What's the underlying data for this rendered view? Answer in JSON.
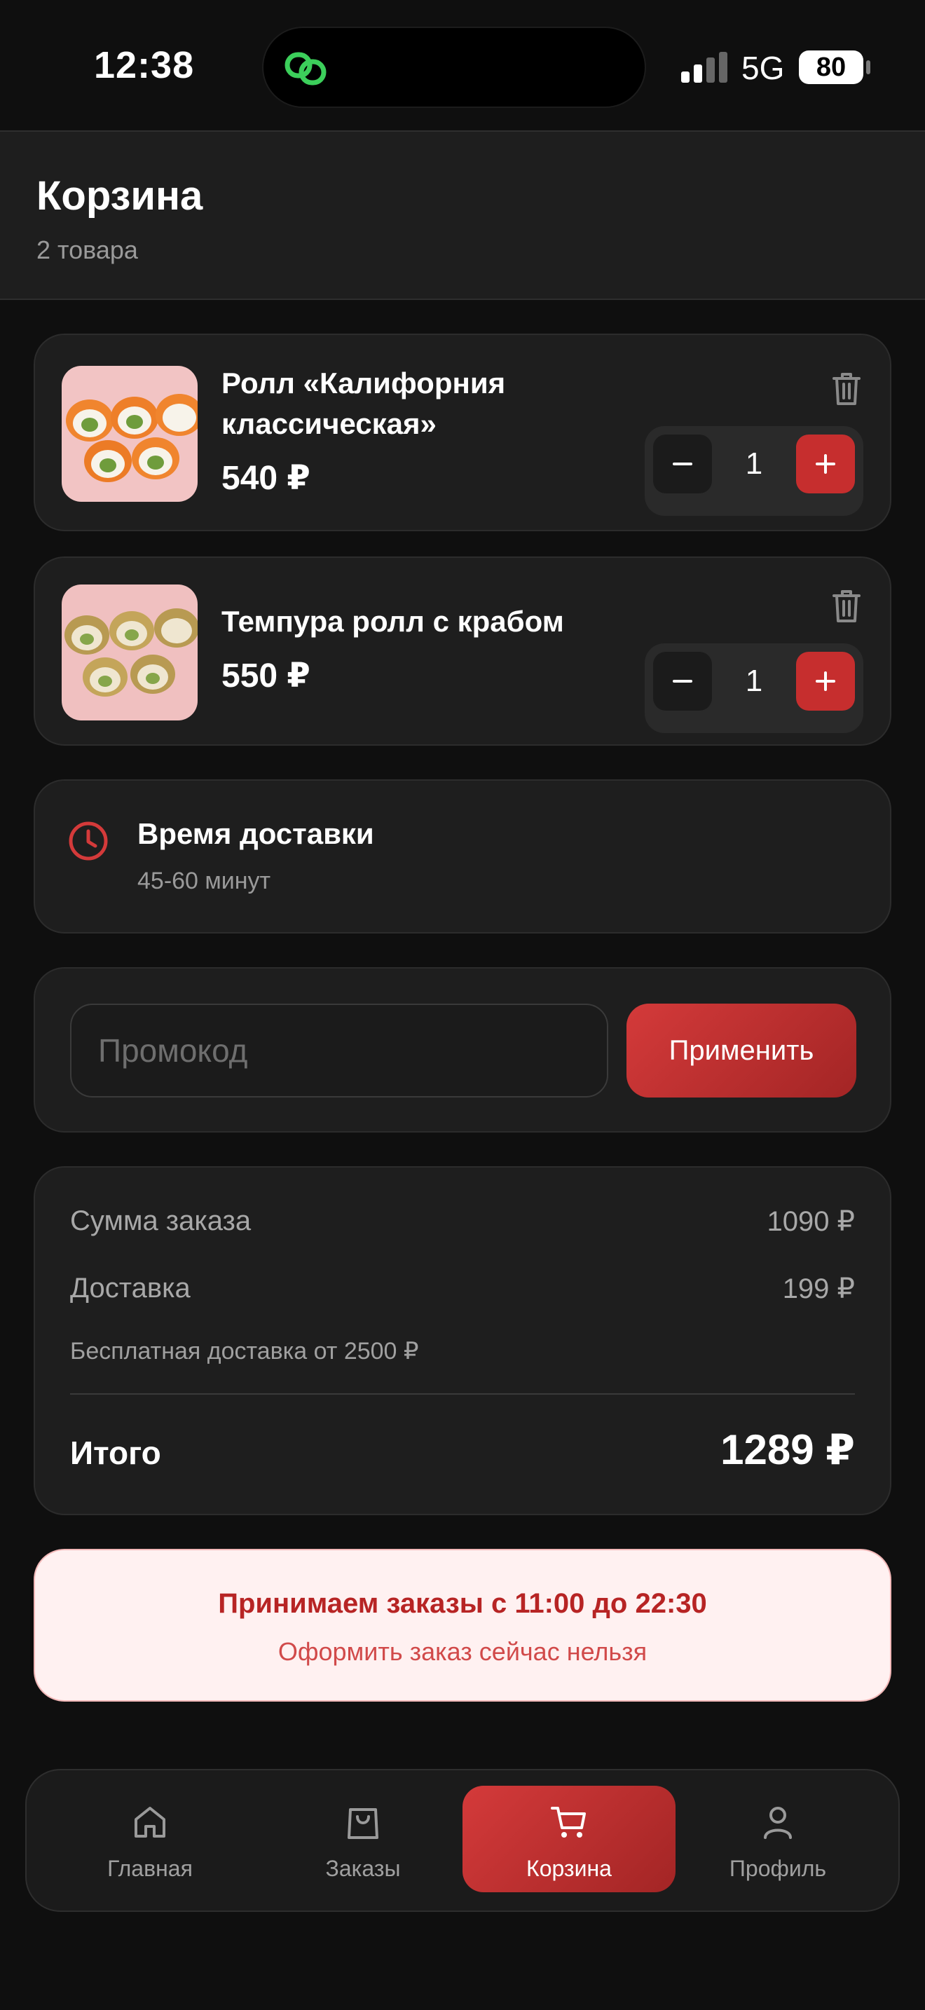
{
  "status_bar": {
    "time": "12:38",
    "network": "5G",
    "battery": "80"
  },
  "header": {
    "title": "Корзина",
    "subtitle": "2 товара"
  },
  "cart": {
    "items": [
      {
        "name": "Ролл «Калифорния классическая»",
        "price": "540 ₽",
        "quantity": "1",
        "icon": "trash-icon"
      },
      {
        "name": "Темпура ролл с крабом",
        "price": "550 ₽",
        "quantity": "1",
        "icon": "trash-icon"
      }
    ]
  },
  "delivery": {
    "title": "Время доставки",
    "time": "45-60 минут",
    "icon": "clock-icon"
  },
  "promo": {
    "placeholder": "Промокод",
    "value": "",
    "apply_label": "Применить"
  },
  "summary": {
    "subtotal_label": "Сумма заказа",
    "subtotal_value": "1090 ₽",
    "delivery_label": "Доставка",
    "delivery_value": "199 ₽",
    "free_delivery_note": "Бесплатная доставка от 2500 ₽",
    "total_label": "Итого",
    "total_value": "1289 ₽"
  },
  "notice": {
    "title": "Принимаем заказы с 11:00 до 22:30",
    "subtitle": "Оформить заказ сейчас нельзя"
  },
  "tabbar": {
    "tabs": [
      {
        "label": "Главная",
        "icon": "home-icon"
      },
      {
        "label": "Заказы",
        "icon": "bag-icon"
      },
      {
        "label": "Корзина",
        "icon": "cart-icon",
        "active": true
      },
      {
        "label": "Профиль",
        "icon": "profile-icon"
      }
    ]
  },
  "colors": {
    "accent": "#c62e2e",
    "background": "#0f0f0f",
    "card": "#1e1e1e",
    "notice_bg": "#fff1f1"
  }
}
